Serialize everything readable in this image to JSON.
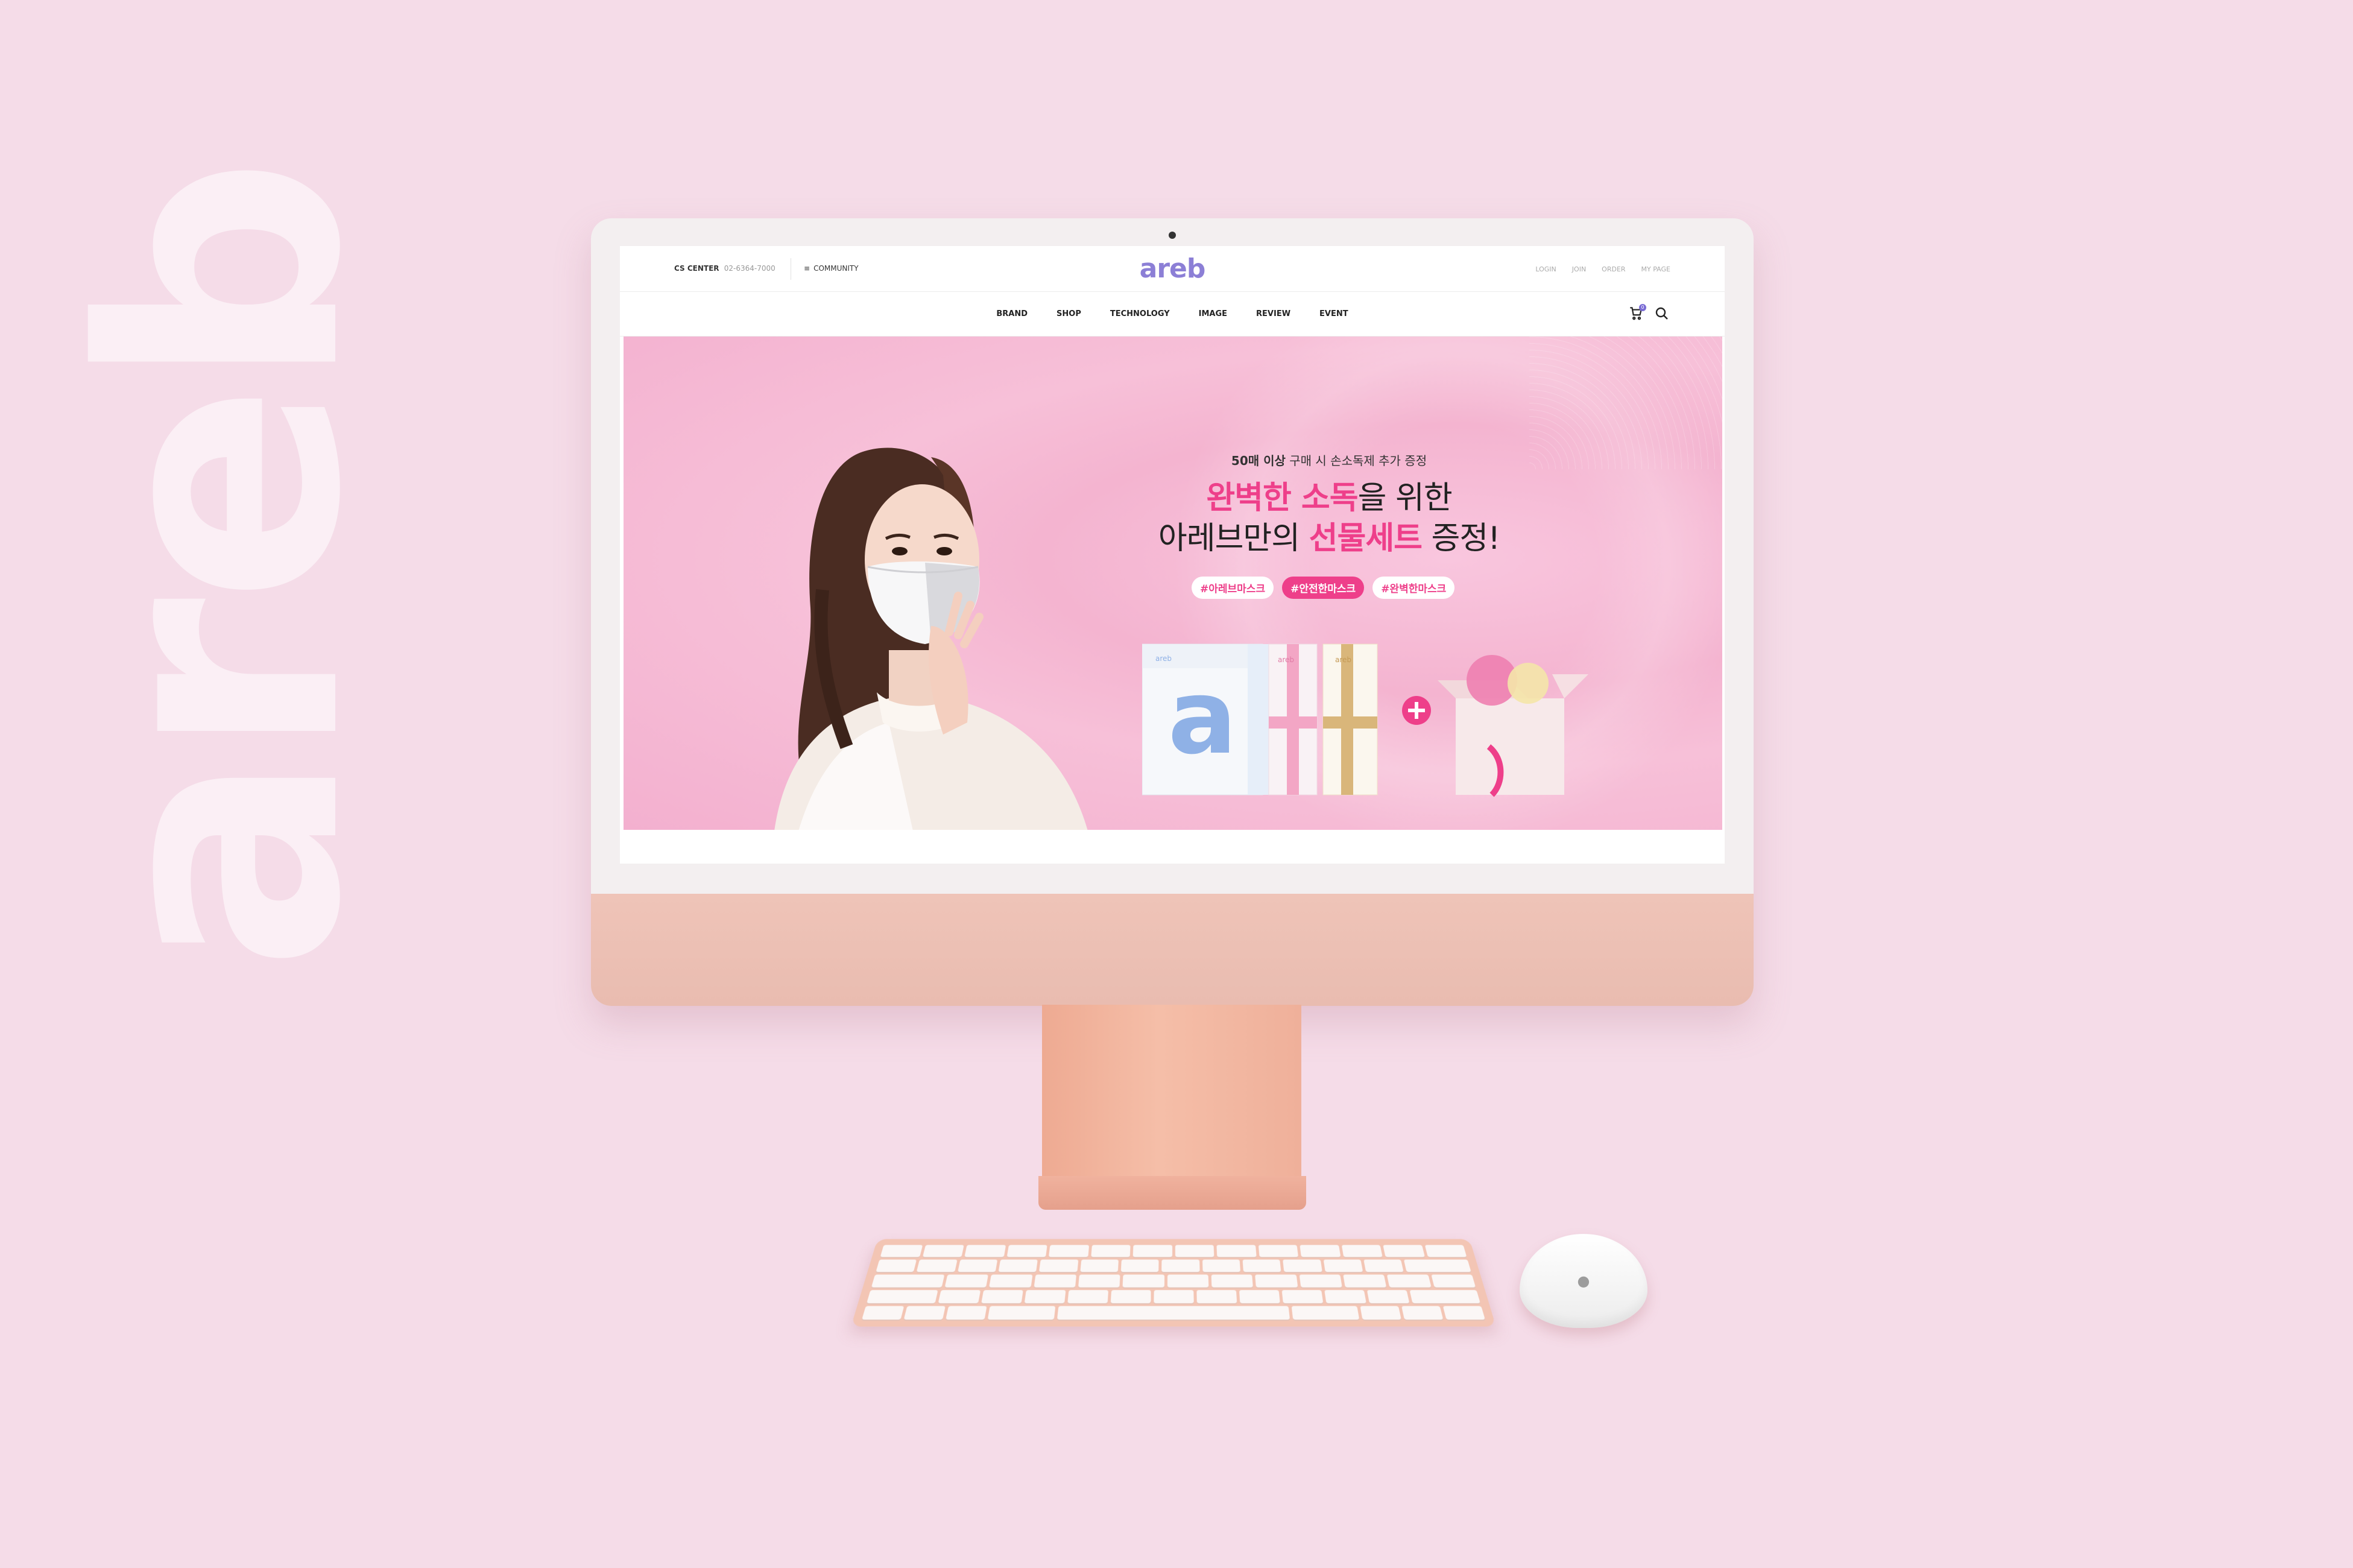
{
  "background": {
    "watermark": "areb",
    "color": "#f5dce8"
  },
  "header": {
    "cs_label": "CS CENTER",
    "cs_phone": "02-6364-7000",
    "community_label": "COMMUNITY",
    "logo": "areb",
    "top_links": [
      "LOGIN",
      "JOIN",
      "ORDER",
      "MY PAGE"
    ]
  },
  "nav": {
    "items": [
      "BRAND",
      "SHOP",
      "TECHNOLOGY",
      "IMAGE",
      "REVIEW",
      "EVENT"
    ],
    "cart_count": "0"
  },
  "hero": {
    "promo_bold": "50매 이상",
    "promo_rest": " 구매 시 손소독제 추가 증정",
    "headline1_pink": "완벽한 소독",
    "headline1_rest": "을 위한",
    "headline2_start": "아레브만의 ",
    "headline2_pink": "선물세트",
    "headline2_end": " 증정!",
    "tags": [
      "#아레브마스크",
      "#안전한마스크",
      "#완벽한마스크"
    ],
    "product_brand": "areb"
  },
  "colors": {
    "accent_pink": "#ee3f8a",
    "logo_purple": "#8c7fd6"
  }
}
